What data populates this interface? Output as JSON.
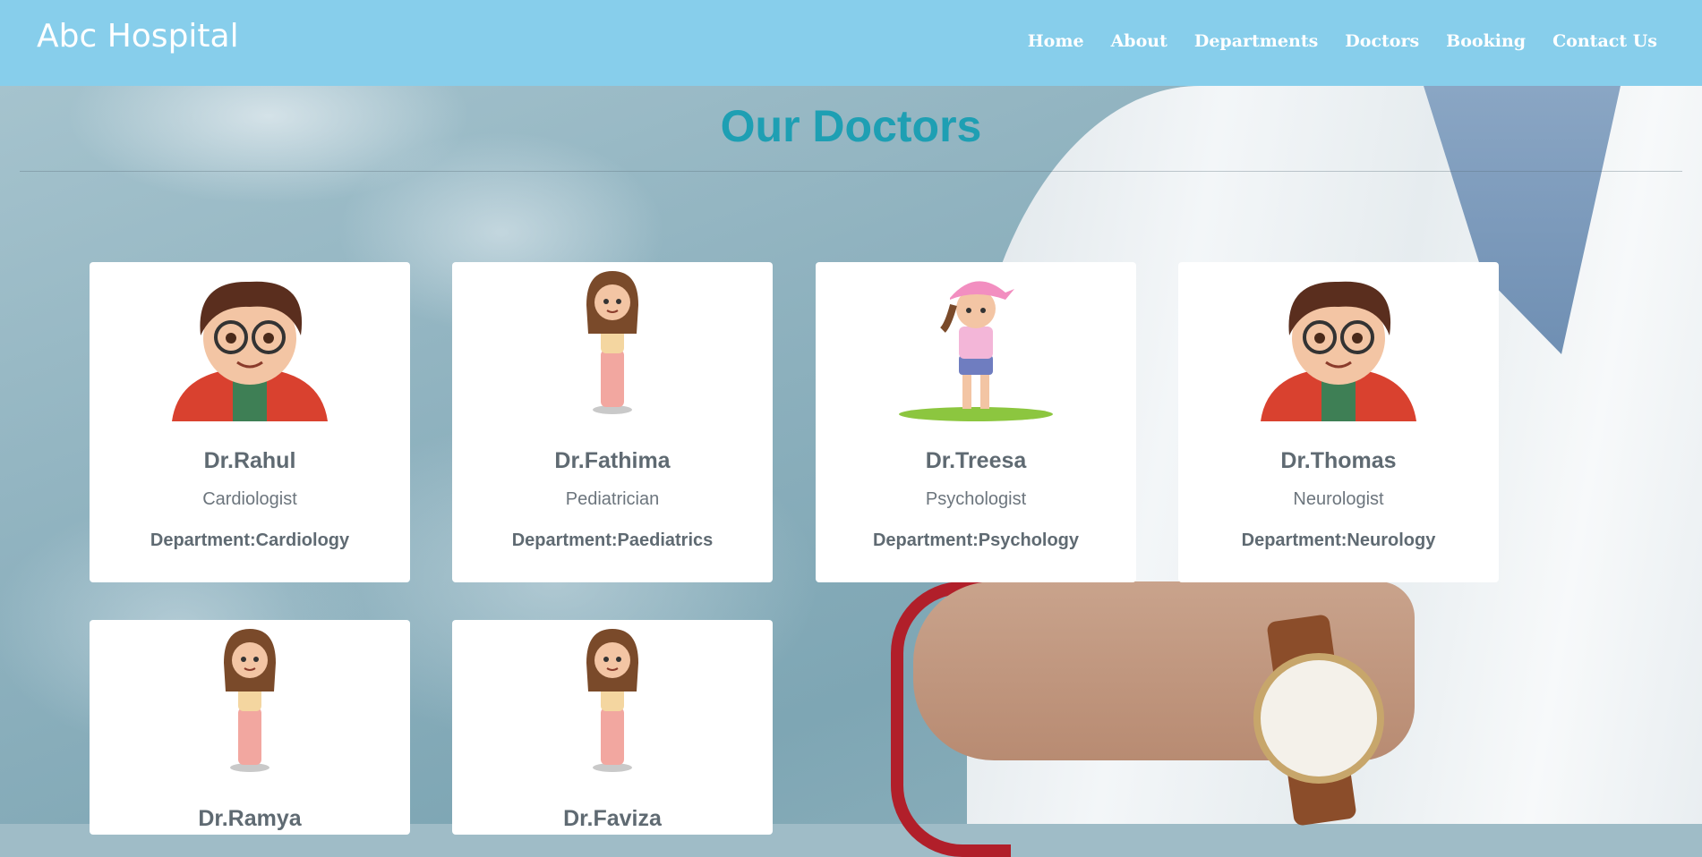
{
  "brand": "Abc Hospital",
  "nav": [
    "Home",
    "About",
    "Departments",
    "Doctors",
    "Booking",
    "Contact Us"
  ],
  "page_title": "Our Doctors",
  "doctors": [
    {
      "name": "Dr.Rahul",
      "specialty": "Cardiologist",
      "department": "Department:Cardiology",
      "avatar": "boy-with-glasses-icon"
    },
    {
      "name": "Dr.Fathima",
      "specialty": "Pediatrician",
      "department": "Department:Paediatrics",
      "avatar": "girl-standing-icon"
    },
    {
      "name": "Dr.Treesa",
      "specialty": "Psychologist",
      "department": "Department:Psychology",
      "avatar": "girl-with-cap-icon"
    },
    {
      "name": "Dr.Thomas",
      "specialty": "Neurologist",
      "department": "Department:Neurology",
      "avatar": "boy-with-glasses-icon"
    },
    {
      "name": "Dr.Ramya",
      "avatar": "girl-standing-icon"
    },
    {
      "name": "Dr.Faviza",
      "avatar": "girl-standing-icon"
    }
  ],
  "colors": {
    "navbar": "#87ceeb",
    "title": "#1e9fb3",
    "card": "#ffffff"
  }
}
